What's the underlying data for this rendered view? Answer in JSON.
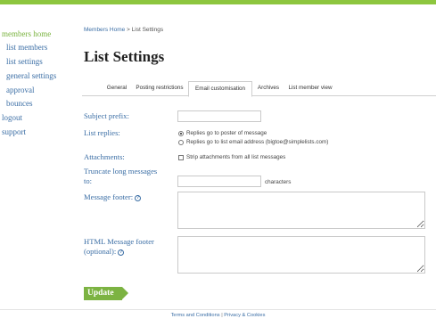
{
  "sidebar": {
    "items": [
      {
        "label": "members home"
      },
      {
        "label": "list members"
      },
      {
        "label": "list settings"
      },
      {
        "label": "general settings"
      },
      {
        "label": "approval"
      },
      {
        "label": "bounces"
      },
      {
        "label": "logout"
      },
      {
        "label": "support"
      }
    ]
  },
  "breadcrumb": {
    "home": "Members Home",
    "separator": ">",
    "current": "List Settings"
  },
  "page_title": "List Settings",
  "tabs": [
    {
      "label": "General"
    },
    {
      "label": "Posting restrictions"
    },
    {
      "label": "Email customisation",
      "active": true
    },
    {
      "label": "Archives"
    },
    {
      "label": "List member view"
    }
  ],
  "form": {
    "subject_prefix": {
      "label": "Subject prefix:",
      "value": ""
    },
    "list_replies": {
      "label": "List replies:",
      "options": [
        {
          "label": "Replies go to poster of message",
          "checked": true
        },
        {
          "label": "Replies go to list email address (bigtoe@simplelists.com)",
          "checked": false
        }
      ]
    },
    "attachments": {
      "label": "Attachments:",
      "option": "Strip attachments from all list messages",
      "checked": false
    },
    "truncate": {
      "label_line1": "Truncate long messages",
      "label_line2": "to:",
      "value": "",
      "unit": "characters"
    },
    "message_footer": {
      "label": "Message footer:",
      "help_icon": "?",
      "value": ""
    },
    "html_footer": {
      "label_line1": "HTML Message footer",
      "label_line2": "(optional):",
      "help_icon": "?",
      "value": ""
    }
  },
  "update_button": {
    "label": "Update"
  },
  "footer": {
    "terms": "Terms and Conditions",
    "separator": "|",
    "privacy": "Privacy & Cookies"
  },
  "colors": {
    "accent_green": "#8dc63f",
    "link_blue": "#3b6ea5"
  }
}
